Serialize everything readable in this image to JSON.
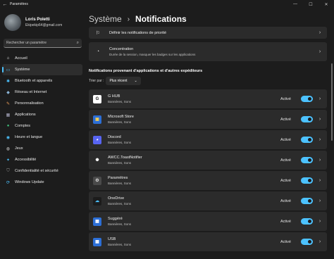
{
  "window": {
    "title": "Paramètres",
    "back_icon": "←",
    "controls": [
      "—",
      "☐",
      "✕"
    ]
  },
  "profile": {
    "name": "Loris Poletti",
    "email": "Ekipekip64@gmail.com"
  },
  "search": {
    "placeholder": "Rechercher un paramètre",
    "icon": "⌕"
  },
  "sidebar": {
    "items": [
      {
        "label": "Accueil",
        "icon": "⌂",
        "icon_name": "home-icon",
        "color": "#e6e6e6",
        "active": false
      },
      {
        "label": "Système",
        "icon": "▭",
        "icon_name": "system-icon",
        "color": "#4cc2ff",
        "active": true
      },
      {
        "label": "Bluetooth et appareils",
        "icon": "✱",
        "icon_name": "bluetooth-icon",
        "color": "#4cc2ff",
        "active": false
      },
      {
        "label": "Réseau et Internet",
        "icon": "◆",
        "icon_name": "network-icon",
        "color": "#8ab4d6",
        "active": false
      },
      {
        "label": "Personnalisation",
        "icon": "✎",
        "icon_name": "brush-icon",
        "color": "#f0a05a",
        "active": false
      },
      {
        "label": "Applications",
        "icon": "▦",
        "icon_name": "apps-icon",
        "color": "#b0b0c8",
        "active": false
      },
      {
        "label": "Comptes",
        "icon": "●",
        "icon_name": "accounts-icon",
        "color": "#3fc07a",
        "active": false
      },
      {
        "label": "Heure et langue",
        "icon": "◉",
        "icon_name": "time-language-icon",
        "color": "#4cc2ff",
        "active": false
      },
      {
        "label": "Jeux",
        "icon": "◍",
        "icon_name": "gaming-icon",
        "color": "#c8c8c8",
        "active": false
      },
      {
        "label": "Accessibilité",
        "icon": "✦",
        "icon_name": "accessibility-icon",
        "color": "#4cc2ff",
        "active": false
      },
      {
        "label": "Confidentialité et sécurité",
        "icon": "⛉",
        "icon_name": "shield-icon",
        "color": "#9a9a9a",
        "active": false
      },
      {
        "label": "Windows Update",
        "icon": "⟳",
        "icon_name": "update-icon",
        "color": "#4cc2ff",
        "active": false
      }
    ]
  },
  "breadcrumb": {
    "parent": "Système",
    "separator": "›",
    "current": "Notifications"
  },
  "settings_cards": [
    {
      "title": "Définir les notifications de priorité",
      "subtitle": "",
      "icon": "⚐",
      "icon_name": "priority-icon"
    },
    {
      "title": "Concentration",
      "subtitle": "Durée de la session, masquer les badges sur les applications",
      "icon": "◔",
      "icon_name": "focus-icon"
    }
  ],
  "section_title": "Notifications provenant d'applications et d'autres expéditeurs",
  "sort": {
    "label": "Trier par :",
    "value": "Plus récent",
    "dropdown_icon": "⌄"
  },
  "apps": [
    {
      "name": "G HUB",
      "subtitle": "Bannières, Sons",
      "state": "Activé",
      "on": true,
      "icon": "G",
      "icon_name": "ghub-icon",
      "icon_bg": "#ffffff",
      "icon_fg": "#111111"
    },
    {
      "name": "Microsoft Store",
      "subtitle": "Bannières, Sons",
      "state": "Activé",
      "on": true,
      "icon": "▣",
      "icon_name": "store-icon",
      "icon_bg": "#2d6fd6",
      "icon_fg": "#ffd24a"
    },
    {
      "name": "Discord",
      "subtitle": "Bannières, Sons",
      "state": "Activé",
      "on": true,
      "icon": "◕",
      "icon_name": "discord-icon",
      "icon_bg": "#5865f2",
      "icon_fg": "#ffffff"
    },
    {
      "name": "AWCC.ToastNotifier",
      "subtitle": "Bannières, Sons",
      "state": "Activé",
      "on": true,
      "icon": "✺",
      "icon_name": "alienware-icon",
      "icon_bg": "#2b2b2b",
      "icon_fg": "#ffffff"
    },
    {
      "name": "Paramètres",
      "subtitle": "Bannières, Sons",
      "state": "Activé",
      "on": true,
      "icon": "⚙",
      "icon_name": "settings-icon",
      "icon_bg": "#4a4a4a",
      "icon_fg": "#dddddd"
    },
    {
      "name": "OneDrive",
      "subtitle": "Bannières, Sons",
      "state": "Activé",
      "on": true,
      "icon": "☁",
      "icon_name": "onedrive-icon",
      "icon_bg": "#1c1c1c",
      "icon_fg": "#4cc2ff"
    },
    {
      "name": "Suggéré",
      "subtitle": "Bannières, Sons",
      "state": "Activé",
      "on": true,
      "icon": "▦",
      "icon_name": "suggested-icon",
      "icon_bg": "#2d6fd6",
      "icon_fg": "#ffffff"
    },
    {
      "name": "USB",
      "subtitle": "Bannières, Sons",
      "state": "Activé",
      "on": true,
      "icon": "▦",
      "icon_name": "usb-icon",
      "icon_bg": "#2d6fd6",
      "icon_fg": "#ffffff"
    }
  ],
  "colors": {
    "accent": "#4cc2ff",
    "background": "#1c1c1c",
    "card": "#2b2b2b"
  }
}
